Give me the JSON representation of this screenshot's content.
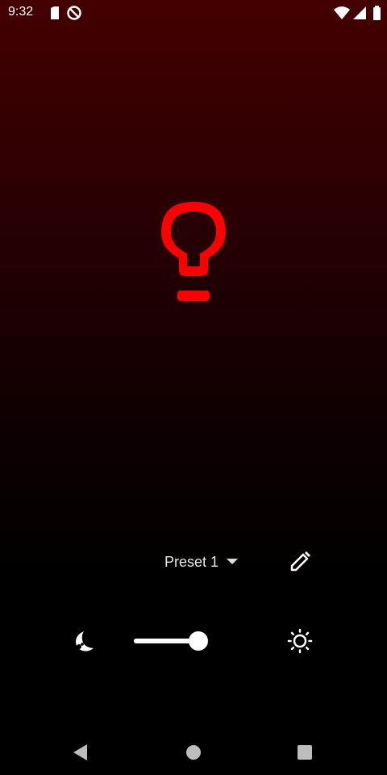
{
  "status_bar": {
    "time": "9:32",
    "icons": [
      "sd-card-icon",
      "no-disturb-icon",
      "wifi-icon",
      "signal-icon",
      "battery-icon"
    ]
  },
  "lamp": {
    "icon": "lightbulb-icon",
    "color": "#ff0000"
  },
  "controls": {
    "preset_label": "Preset 1",
    "edit_icon": "pencil-icon",
    "night_icon": "moon-stars-icon",
    "day_icon": "sun-icon",
    "brightness": 1.0
  },
  "nav": {
    "back_icon": "back-triangle-icon",
    "home_icon": "home-circle-icon",
    "recents_icon": "recents-square-icon"
  },
  "colors": {
    "accent": "#ff0000",
    "gradient_top": "#440000",
    "background": "#000000",
    "foreground": "#ffffff"
  }
}
